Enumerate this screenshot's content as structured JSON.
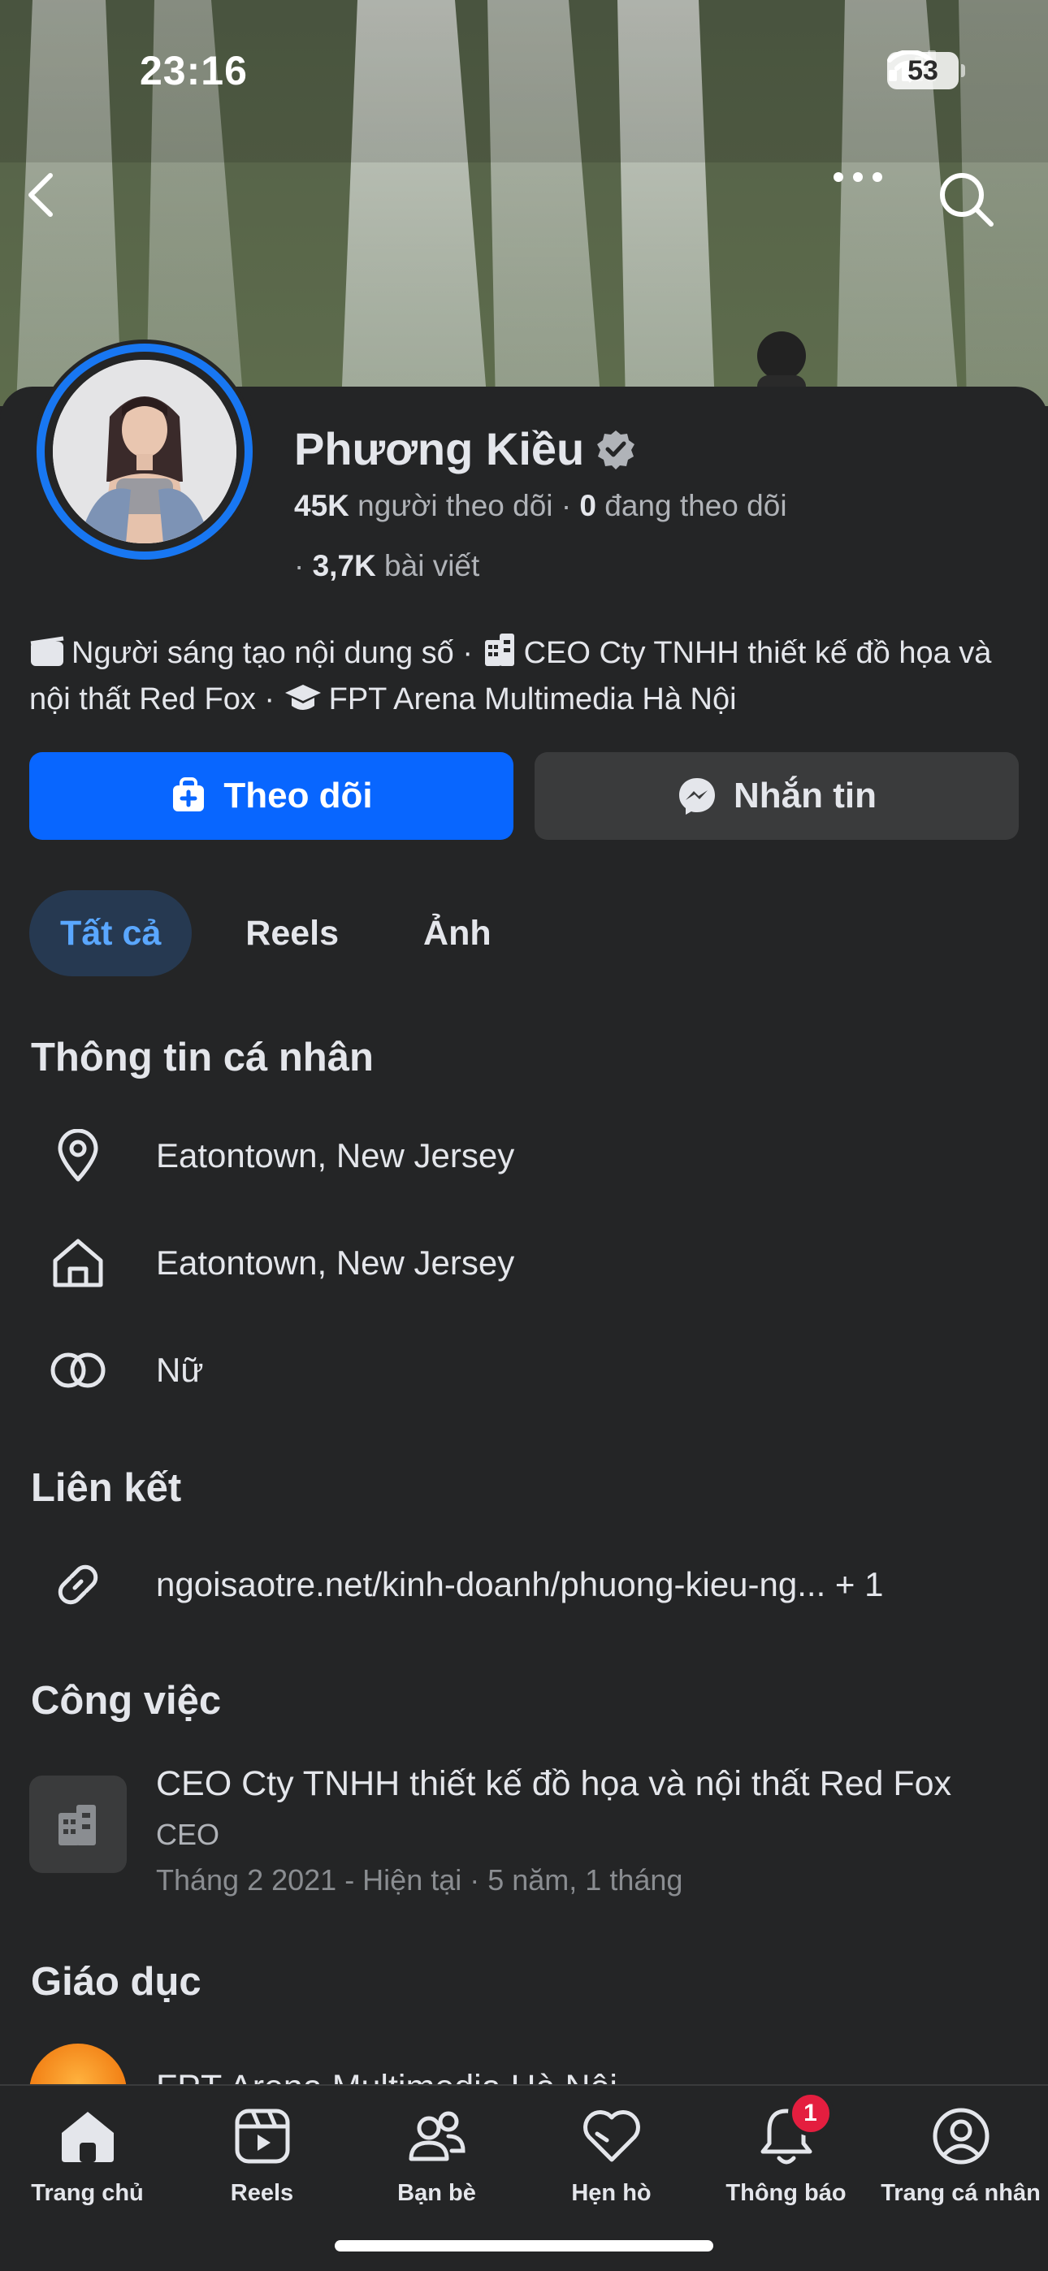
{
  "status_bar": {
    "time": "23:16",
    "battery": "53"
  },
  "profile": {
    "name": "Phương Kiều",
    "followers_count": "45K",
    "followers_label": "người theo dõi",
    "following_count": "0",
    "following_label": "đang theo dõi",
    "posts_count": "3,7K",
    "posts_label": "bài viết",
    "bio": {
      "creator": "Người sáng tạo nội dung số",
      "work": "CEO Cty TNHH thiết kế đồ họa và nội thất Red Fox",
      "school": "FPT Arena Multimedia Hà Nội"
    }
  },
  "actions": {
    "follow": "Theo dõi",
    "message": "Nhắn tin"
  },
  "tabs": [
    {
      "label": "Tất cả"
    },
    {
      "label": "Reels"
    },
    {
      "label": "Ảnh"
    }
  ],
  "personal_info": {
    "title": "Thông tin cá nhân",
    "current_city": "Eatontown, New Jersey",
    "hometown": "Eatontown, New Jersey",
    "gender": "Nữ"
  },
  "links": {
    "title": "Liên kết",
    "url": "ngoisaotre.net/kinh-doanh/phuong-kieu-ng... + 1"
  },
  "work": {
    "title": "Công việc",
    "company": "CEO Cty TNHH thiết kế đồ họa và nội thất Red Fox",
    "role": "CEO",
    "dates": "Tháng 2 2021 - Hiện tại · 5 năm, 1 tháng"
  },
  "education": {
    "title": "Giáo dục",
    "school": "FPT Arena Multimedia Hà Nội"
  },
  "bottom_nav": [
    {
      "label": "Trang chủ",
      "icon": "home-icon"
    },
    {
      "label": "Reels",
      "icon": "reels-icon"
    },
    {
      "label": "Bạn bè",
      "icon": "friends-icon"
    },
    {
      "label": "Hẹn hò",
      "icon": "dating-heart-icon"
    },
    {
      "label": "Thông báo",
      "icon": "bell-icon",
      "badge": "1"
    },
    {
      "label": "Trang cá nhân",
      "icon": "profile-icon"
    }
  ],
  "colors": {
    "accent": "#0866ff",
    "background": "#242526",
    "secondary_button": "#3a3b3c",
    "badge": "#e41e3f",
    "active_tab_text": "#5aa7ff"
  }
}
